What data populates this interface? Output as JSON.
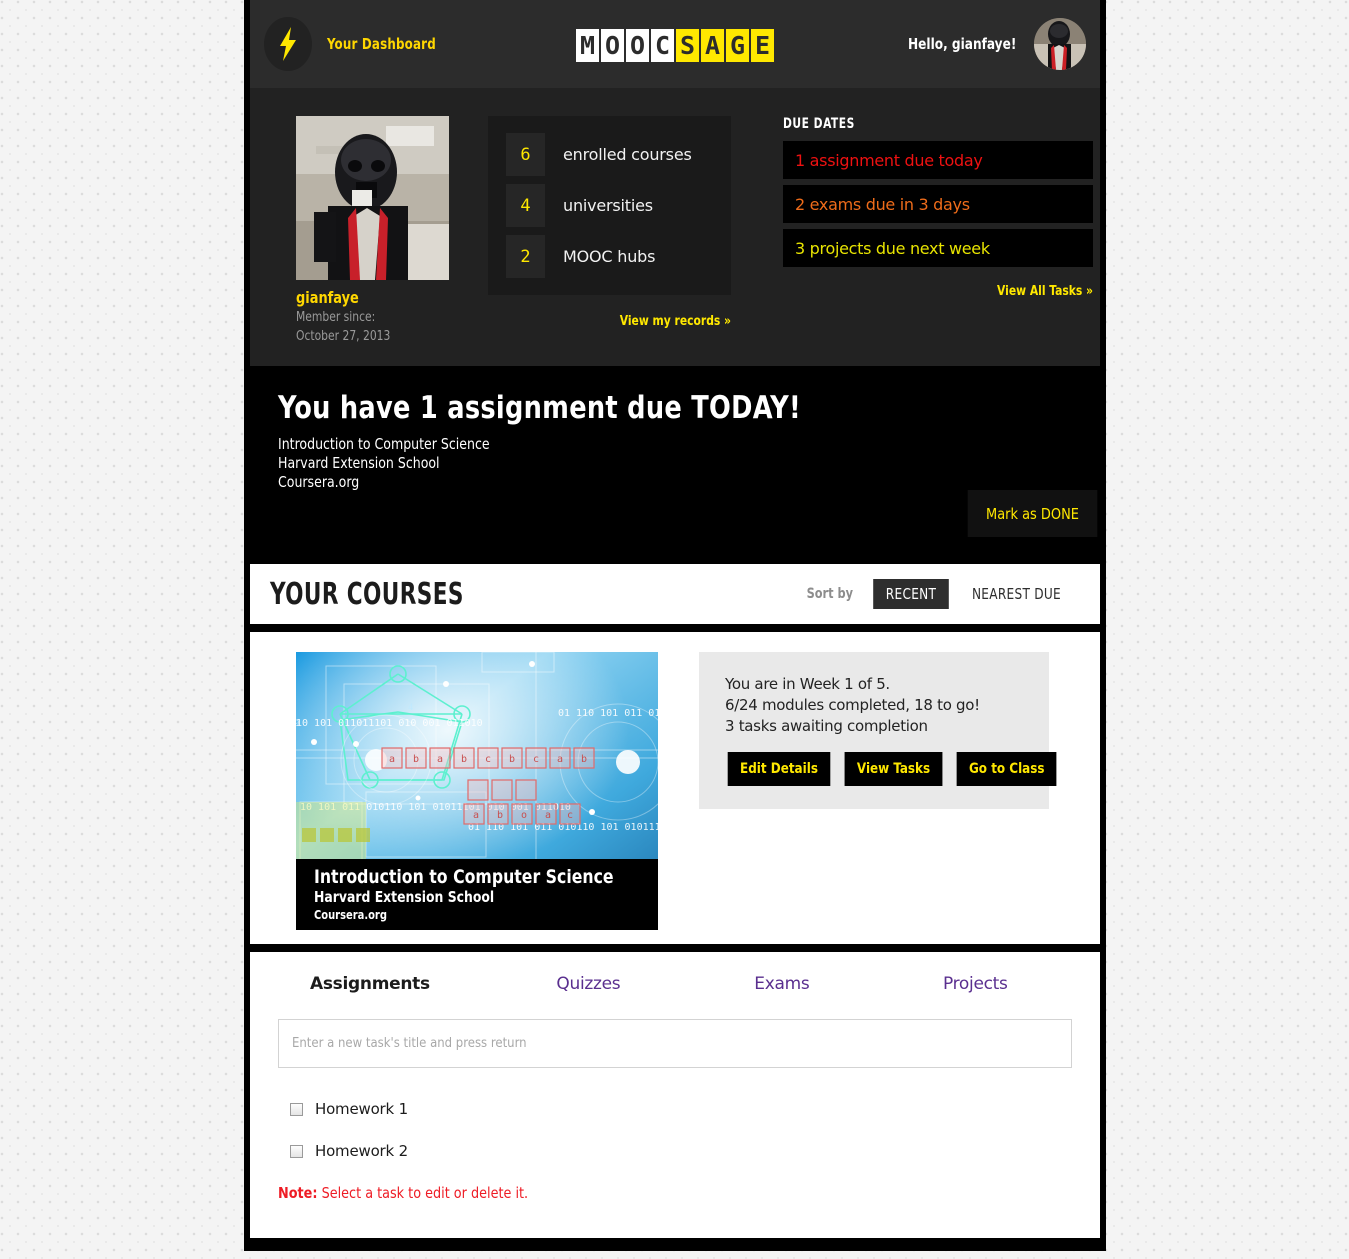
{
  "header": {
    "logo_icon": "lightning-bolt-icon",
    "dashboard_link": "Your Dashboard",
    "brand_part1": "MOOC",
    "brand_part2": "SAGE",
    "brand_letters_white": [
      "M",
      "O",
      "O",
      "C"
    ],
    "brand_letters_yellow": [
      "S",
      "A",
      "G",
      "E"
    ],
    "greeting": "Hello, gianfaye!",
    "avatar_alt": "user-avatar"
  },
  "profile": {
    "username": "gianfaye",
    "member_since_label": "Member since:",
    "member_since_date": "October 27, 2013"
  },
  "stats": {
    "items": [
      {
        "count": "6",
        "label": "enrolled courses"
      },
      {
        "count": "4",
        "label": "universities"
      },
      {
        "count": "2",
        "label": "MOOC hubs"
      }
    ],
    "records_link": "View my records »"
  },
  "due_dates": {
    "title": "DUE DATES",
    "items": [
      {
        "text": "1 assignment due today",
        "color": "#ee1111"
      },
      {
        "text": "2 exams due in 3 days",
        "color": "#ef6c1a"
      },
      {
        "text": "3 projects due next week",
        "color": "#e8e400"
      }
    ],
    "view_all_link": "View All Tasks »"
  },
  "alert": {
    "headline": "You have 1 assignment due TODAY!",
    "course": "Introduction to Computer Science",
    "school": "Harvard Extension School",
    "provider": "Coursera.org",
    "done_button": "Mark as DONE"
  },
  "courses_bar": {
    "title": "YOUR COURSES",
    "sort_label": "Sort by",
    "sort_options": [
      "RECENT",
      "NEAREST DUE"
    ],
    "sort_active": "RECENT"
  },
  "course_card": {
    "thumb_title": "Introduction to Computer Science",
    "thumb_school": "Harvard Extension School",
    "thumb_provider": "Coursera.org",
    "week_line": "You are in Week 1 of 5.",
    "modules_line": "6/24 modules completed, 18 to go!",
    "tasks_line": "3 tasks awaiting completion",
    "buttons": [
      "Edit Details",
      "View Tasks",
      "Go to Class"
    ]
  },
  "tasks": {
    "tabs": [
      {
        "label": "Assignments",
        "active": true
      },
      {
        "label": "Quizzes",
        "active": false
      },
      {
        "label": "Exams",
        "active": false
      },
      {
        "label": "Projects",
        "active": false
      }
    ],
    "input_placeholder": "Enter a new task's title and press return",
    "input_value": "",
    "items": [
      {
        "label": "Homework 1",
        "checked": false
      },
      {
        "label": "Homework 2",
        "checked": false
      }
    ],
    "note_prefix": "Note:",
    "note_text": " Select a task to edit or delete it."
  },
  "colors": {
    "accent_yellow": "#ffe800",
    "link_yellow": "#ffd700",
    "note_red": "#ee1c25",
    "tab_purple": "#5a2f8f",
    "header_bg": "#2c2c2c",
    "panel_bg": "#222222"
  }
}
